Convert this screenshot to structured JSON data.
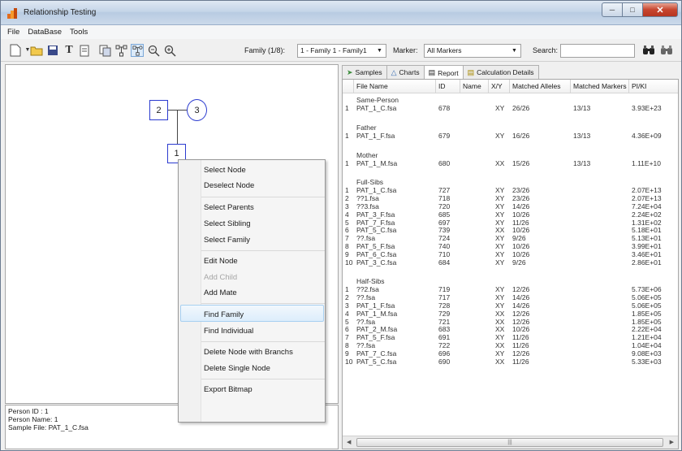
{
  "window": {
    "title": "Relationship Testing"
  },
  "menu": [
    "File",
    "DataBase",
    "Tools"
  ],
  "toolbar": {
    "family_label": "Family (1/8):",
    "family_value": "1 - Family 1 - Family1",
    "marker_label": "Marker:",
    "marker_value": "All Markers",
    "search_label": "Search:",
    "search_value": ""
  },
  "tree": {
    "node_father": "2",
    "node_mother": "3",
    "node_child": "1"
  },
  "context_menu": {
    "items": [
      {
        "label": "Select Node",
        "enabled": true
      },
      {
        "label": "Deselect Node",
        "enabled": true
      },
      {
        "label": "Select Parents",
        "enabled": true
      },
      {
        "label": "Select Sibling",
        "enabled": true
      },
      {
        "label": "Select Family",
        "enabled": true
      },
      {
        "label": "Edit Node",
        "enabled": true
      },
      {
        "label": "Add Child",
        "enabled": false
      },
      {
        "label": "Add Mate",
        "enabled": true
      },
      {
        "label": "Find Family",
        "enabled": true,
        "highlighted": true
      },
      {
        "label": "Find Individual",
        "enabled": true
      },
      {
        "label": "Delete Node with Branchs",
        "enabled": true
      },
      {
        "label": "Delete Single Node",
        "enabled": true
      },
      {
        "label": "Export Bitmap",
        "enabled": true
      }
    ]
  },
  "info": {
    "person_id": "Person ID : 1",
    "person_name": "Person Name: 1",
    "sample_file": "Sample File: PAT_1_C.fsa"
  },
  "tabs": [
    {
      "label": "Samples",
      "icon": "samples-icon"
    },
    {
      "label": "Charts",
      "icon": "charts-icon"
    },
    {
      "label": "Report",
      "icon": "report-icon",
      "active": true
    },
    {
      "label": "Calculation Details",
      "icon": "calc-icon"
    }
  ],
  "report": {
    "columns": [
      "File Name",
      "ID",
      "Name",
      "X/Y",
      "Matched Alleles",
      "Matched Markers",
      "PI/KI"
    ],
    "groups": [
      {
        "title": "Same-Person",
        "rows": [
          [
            "1",
            "PAT_1_C.fsa",
            "678",
            "",
            "XY",
            "26/26",
            "13/13",
            "3.93E+23"
          ]
        ]
      },
      {
        "title": "Father",
        "rows": [
          [
            "1",
            "PAT_1_F.fsa",
            "679",
            "",
            "XY",
            "16/26",
            "13/13",
            "4.36E+09"
          ]
        ]
      },
      {
        "title": "Mother",
        "rows": [
          [
            "1",
            "PAT_1_M.fsa",
            "680",
            "",
            "XX",
            "15/26",
            "13/13",
            "1.11E+10"
          ]
        ]
      },
      {
        "title": "Full-Sibs",
        "rows": [
          [
            "1",
            "PAT_1_C.fsa",
            "727",
            "",
            "XY",
            "23/26",
            "",
            "2.07E+13"
          ],
          [
            "2",
            "??1.fsa",
            "718",
            "",
            "XY",
            "23/26",
            "",
            "2.07E+13"
          ],
          [
            "3",
            "??3.fsa",
            "720",
            "",
            "XY",
            "14/26",
            "",
            "7.24E+04"
          ],
          [
            "4",
            "PAT_3_F.fsa",
            "685",
            "",
            "XY",
            "10/26",
            "",
            "2.24E+02"
          ],
          [
            "5",
            "PAT_7_F.fsa",
            "697",
            "",
            "XY",
            "11/26",
            "",
            "1.31E+02"
          ],
          [
            "6",
            "PAT_5_C.fsa",
            "739",
            "",
            "XX",
            "10/26",
            "",
            "5.18E+01"
          ],
          [
            "7",
            "??.fsa",
            "724",
            "",
            "XY",
            "9/26",
            "",
            "5.13E+01"
          ],
          [
            "8",
            "PAT_5_F.fsa",
            "740",
            "",
            "XY",
            "10/26",
            "",
            "3.99E+01"
          ],
          [
            "9",
            "PAT_6_C.fsa",
            "710",
            "",
            "XY",
            "10/26",
            "",
            "3.46E+01"
          ],
          [
            "10",
            "PAT_3_C.fsa",
            "684",
            "",
            "XY",
            "9/26",
            "",
            "2.86E+01"
          ]
        ]
      },
      {
        "title": "Half-Sibs",
        "rows": [
          [
            "1",
            "??2.fsa",
            "719",
            "",
            "XY",
            "12/26",
            "",
            "5.73E+06"
          ],
          [
            "2",
            "??.fsa",
            "717",
            "",
            "XY",
            "14/26",
            "",
            "5.06E+05"
          ],
          [
            "3",
            "PAT_1_F.fsa",
            "728",
            "",
            "XY",
            "14/26",
            "",
            "5.06E+05"
          ],
          [
            "4",
            "PAT_1_M.fsa",
            "729",
            "",
            "XX",
            "12/26",
            "",
            "1.85E+05"
          ],
          [
            "5",
            "??.fsa",
            "721",
            "",
            "XX",
            "12/26",
            "",
            "1.85E+05"
          ],
          [
            "6",
            "PAT_2_M.fsa",
            "683",
            "",
            "XX",
            "10/26",
            "",
            "2.22E+04"
          ],
          [
            "7",
            "PAT_5_F.fsa",
            "691",
            "",
            "XY",
            "11/26",
            "",
            "1.21E+04"
          ],
          [
            "8",
            "??.fsa",
            "722",
            "",
            "XX",
            "11/26",
            "",
            "1.04E+04"
          ],
          [
            "9",
            "PAT_7_C.fsa",
            "696",
            "",
            "XY",
            "12/26",
            "",
            "9.08E+03"
          ],
          [
            "10",
            "PAT_5_C.fsa",
            "690",
            "",
            "XX",
            "11/26",
            "",
            "5.33E+03"
          ]
        ]
      }
    ]
  },
  "colors": {
    "node_border": "#2b3bcf",
    "hover": "#dcedfb"
  }
}
